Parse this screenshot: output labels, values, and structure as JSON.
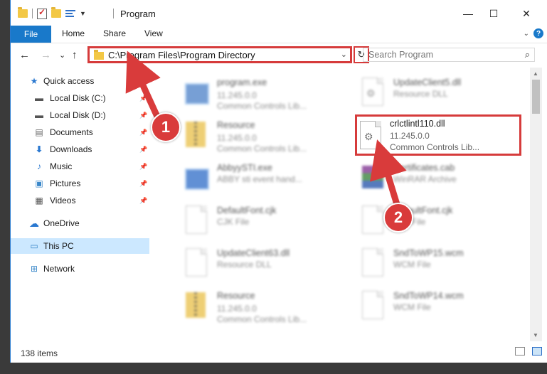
{
  "window": {
    "title": "Program",
    "minimize": "—",
    "maximize": "☐",
    "close": "✕"
  },
  "ribbon": {
    "tabs": [
      "File",
      "Home",
      "Share",
      "View"
    ]
  },
  "nav": {
    "back": "←",
    "forward": "→",
    "recent": "⌄",
    "up": "↑",
    "address": "C:\\Program Files\\Program Directory",
    "refresh": "↻",
    "search_placeholder": "Search Program"
  },
  "sidebar": {
    "items": [
      {
        "label": "Quick access",
        "icon": "star-icon",
        "pinned": false
      },
      {
        "label": "Local Disk (C:)",
        "icon": "drive-icon",
        "pinned": true
      },
      {
        "label": "Local Disk (D:)",
        "icon": "drive-icon",
        "pinned": true
      },
      {
        "label": "Documents",
        "icon": "documents-icon",
        "pinned": true
      },
      {
        "label": "Downloads",
        "icon": "download-icon",
        "pinned": true
      },
      {
        "label": "Music",
        "icon": "music-icon",
        "pinned": true
      },
      {
        "label": "Pictures",
        "icon": "pictures-icon",
        "pinned": true
      },
      {
        "label": "Videos",
        "icon": "videos-icon",
        "pinned": true
      },
      {
        "label": "OneDrive",
        "icon": "cloud-icon",
        "pinned": false
      },
      {
        "label": "This PC",
        "icon": "computer-icon",
        "pinned": false,
        "selected": true
      },
      {
        "label": "Network",
        "icon": "network-icon",
        "pinned": false
      }
    ]
  },
  "files": [
    {
      "name": "program.exe",
      "version": "11.245.0.0",
      "type": "Common Controls Lib...",
      "icon": "exe-icon"
    },
    {
      "name": "UpdateClient5.dll",
      "version": "",
      "type": "Resource DLL",
      "icon": "dll-icon"
    },
    {
      "name": "Resource",
      "version": "11.245.0.0",
      "type": "Common Controls Lib...",
      "icon": "zip-icon"
    },
    {
      "name": "crlctlintl110.dll",
      "version": "11.245.0.0",
      "type": "Common Controls Lib...",
      "icon": "dll-icon",
      "highlighted": true
    },
    {
      "name": "AbbyySTI.exe",
      "version": "",
      "type": "ABBY sti event hand...",
      "icon": "exe-icon"
    },
    {
      "name": "Certificates.cab",
      "version": "",
      "type": "WinRAR Archive",
      "icon": "rar-icon"
    },
    {
      "name": "DefaultFont.cjk",
      "version": "",
      "type": "CJK File",
      "icon": "file-icon"
    },
    {
      "name": "DefaultFont.cjk",
      "version": "",
      "type": "CJK File",
      "icon": "file-icon"
    },
    {
      "name": "UpdateClient63.dll",
      "version": "",
      "type": "Resource DLL",
      "icon": "file-icon"
    },
    {
      "name": "SndToWP15.wcm",
      "version": "",
      "type": "WCM File",
      "icon": "file-icon"
    },
    {
      "name": "Resource",
      "version": "11.245.0.0",
      "type": "Common Controls Lib...",
      "icon": "zip-icon"
    },
    {
      "name": "SndToWP14.wcm",
      "version": "",
      "type": "WCM File",
      "icon": "file-icon"
    }
  ],
  "status": {
    "count": "138 items"
  },
  "annotations": {
    "step1": "1",
    "step2": "2",
    "color": "#d93b3b"
  }
}
